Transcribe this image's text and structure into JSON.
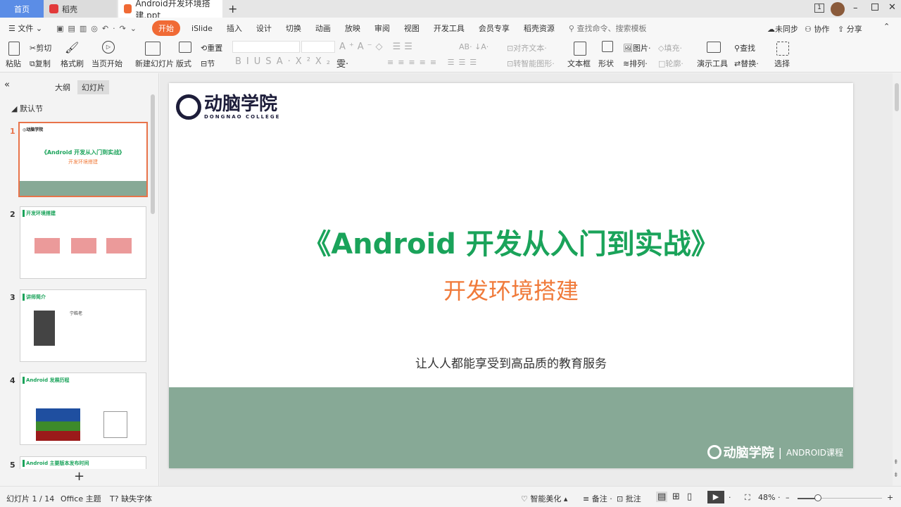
{
  "tabs": {
    "home": "首页",
    "daoke": "稻壳",
    "doc": "Android开发环境搭建.ppt",
    "new_tab": "+",
    "window_badge": "1"
  },
  "menu": {
    "file": "文件",
    "items": [
      "开始",
      "iSlide",
      "插入",
      "设计",
      "切换",
      "动画",
      "放映",
      "审阅",
      "视图",
      "开发工具",
      "会员专享",
      "稻壳资源"
    ],
    "search_placeholder": "查找命令、搜索模板",
    "sync": "未同步",
    "collab": "协作",
    "share": "分享"
  },
  "ribbon": {
    "paste": "粘贴",
    "cut": "剪切",
    "copy": "复制",
    "format_painter": "格式刷",
    "play_current": "当页开始",
    "new_slide": "新建幻灯片",
    "layout": "版式",
    "reset": "重置",
    "section": "节",
    "align_text": "对齐文本",
    "smart_art": "转智能图形",
    "textbox": "文本框",
    "shape": "形状",
    "picture": "图片",
    "fill": "填充",
    "arrange": "排列",
    "outline": "轮廓",
    "present_tools": "演示工具",
    "find": "查找",
    "replace": "替换",
    "select": "选择"
  },
  "panel": {
    "tab_outline": "大纲",
    "tab_slides": "幻灯片",
    "section": "默认节",
    "add": "+",
    "thumbs": [
      {
        "num": "1",
        "title": "《Android 开发从入门到实战》",
        "subtitle": "开发环境搭建"
      },
      {
        "num": "2",
        "title": "开发环境搭建"
      },
      {
        "num": "3",
        "title": "讲师简介",
        "name": "宁皓老"
      },
      {
        "num": "4",
        "title": "Android 发展历程"
      },
      {
        "num": "5",
        "title": "Android 主要版本发布时间"
      }
    ]
  },
  "slide": {
    "logo_cn": "动脑学院",
    "logo_en": "DONGNAO COLLEGE",
    "title": "《Android 开发从入门到实战》",
    "subtitle": "开发环境搭建",
    "tagline": "让人人都能享受到高品质的教育服务",
    "footer_course": "ANDROID课程",
    "colors": {
      "title": "#1aa35a",
      "subtitle": "#f07a3a",
      "band": "#87a996"
    }
  },
  "status": {
    "slide_count": "幻灯片 1 / 14",
    "theme": "Office 主题",
    "missing_font": "缺失字体",
    "beautify": "智能美化",
    "notes": "备注",
    "comment": "批注",
    "zoom": "48%",
    "zoom_fraction": 0.48
  }
}
